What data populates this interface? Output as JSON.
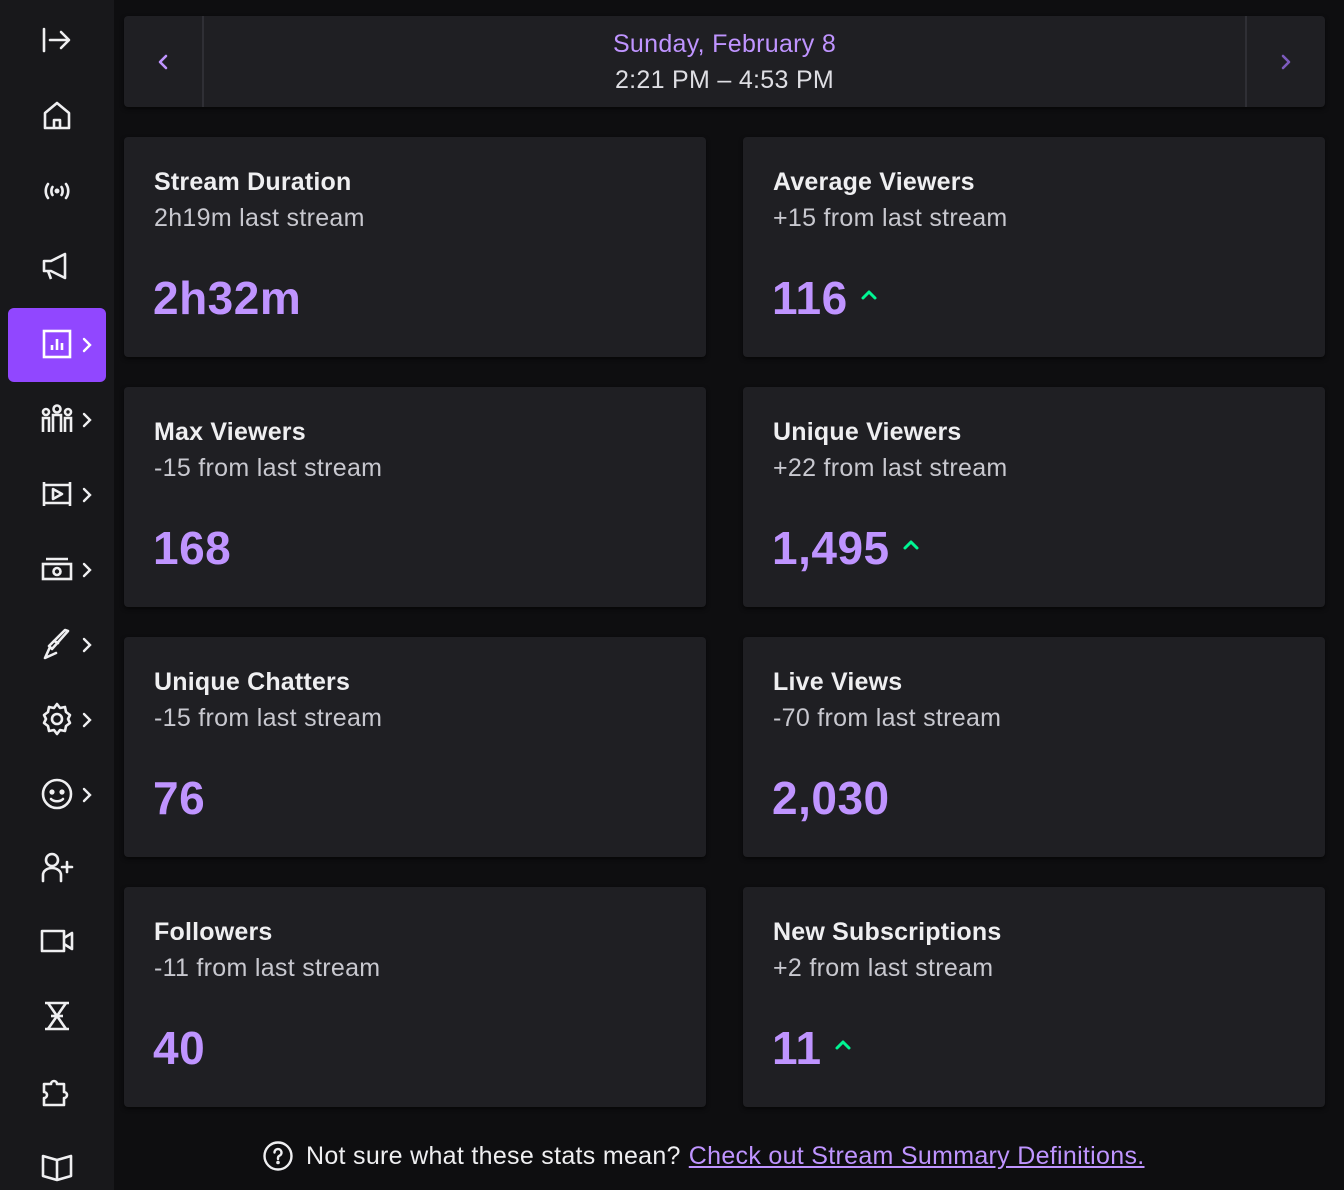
{
  "sidebar": {
    "items": [
      {
        "icon": "collapse-arrow-icon",
        "active": false,
        "chevron": false
      },
      {
        "icon": "home-icon",
        "active": false,
        "chevron": false
      },
      {
        "icon": "broadcast-icon",
        "active": false,
        "chevron": false
      },
      {
        "icon": "megaphone-icon",
        "active": false,
        "chevron": false
      },
      {
        "icon": "analytics-icon",
        "active": true,
        "chevron": true
      },
      {
        "icon": "community-icon",
        "active": false,
        "chevron": true
      },
      {
        "icon": "content-icon",
        "active": false,
        "chevron": true
      },
      {
        "icon": "monetization-icon",
        "active": false,
        "chevron": true
      },
      {
        "icon": "creator-tools-icon",
        "active": false,
        "chevron": true
      },
      {
        "icon": "settings-icon",
        "active": false,
        "chevron": true
      },
      {
        "icon": "viewer-rewards-icon",
        "active": false,
        "chevron": true
      },
      {
        "icon": "add-friend-icon",
        "active": false,
        "chevron": false
      },
      {
        "icon": "video-icon",
        "active": false,
        "chevron": false
      },
      {
        "icon": "bits-icon",
        "active": false,
        "chevron": false
      },
      {
        "icon": "extensions-icon",
        "active": false,
        "chevron": false
      },
      {
        "icon": "book-icon",
        "active": false,
        "chevron": false
      }
    ]
  },
  "date_header": {
    "day": "Sunday, February 8",
    "range": "2:21 PM – 4:53 PM"
  },
  "stats": [
    {
      "title": "Stream Duration",
      "sub": "2h19m last stream",
      "value": "2h32m",
      "trend": "none"
    },
    {
      "title": "Average Viewers",
      "sub": "+15 from last stream",
      "value": "116",
      "trend": "up"
    },
    {
      "title": "Max Viewers",
      "sub": "-15 from last stream",
      "value": "168",
      "trend": "none"
    },
    {
      "title": "Unique Viewers",
      "sub": "+22 from last stream",
      "value": "1,495",
      "trend": "up"
    },
    {
      "title": "Unique Chatters",
      "sub": "-15 from last stream",
      "value": "76",
      "trend": "none"
    },
    {
      "title": "Live Views",
      "sub": "-70 from last stream",
      "value": "2,030",
      "trend": "none"
    },
    {
      "title": "Followers",
      "sub": "-11 from last stream",
      "value": "40",
      "trend": "none"
    },
    {
      "title": "New Subscriptions",
      "sub": "+2 from last stream",
      "value": "11",
      "trend": "up"
    }
  ],
  "footer": {
    "question": "Not sure what these stats mean?",
    "link_text": "Check out Stream Summary Definitions."
  },
  "colors": {
    "accent": "#9147ff",
    "accent_text": "#bf94ff",
    "trend_up": "#00f593",
    "background": "#0e0e10",
    "card": "#1f1f23"
  }
}
